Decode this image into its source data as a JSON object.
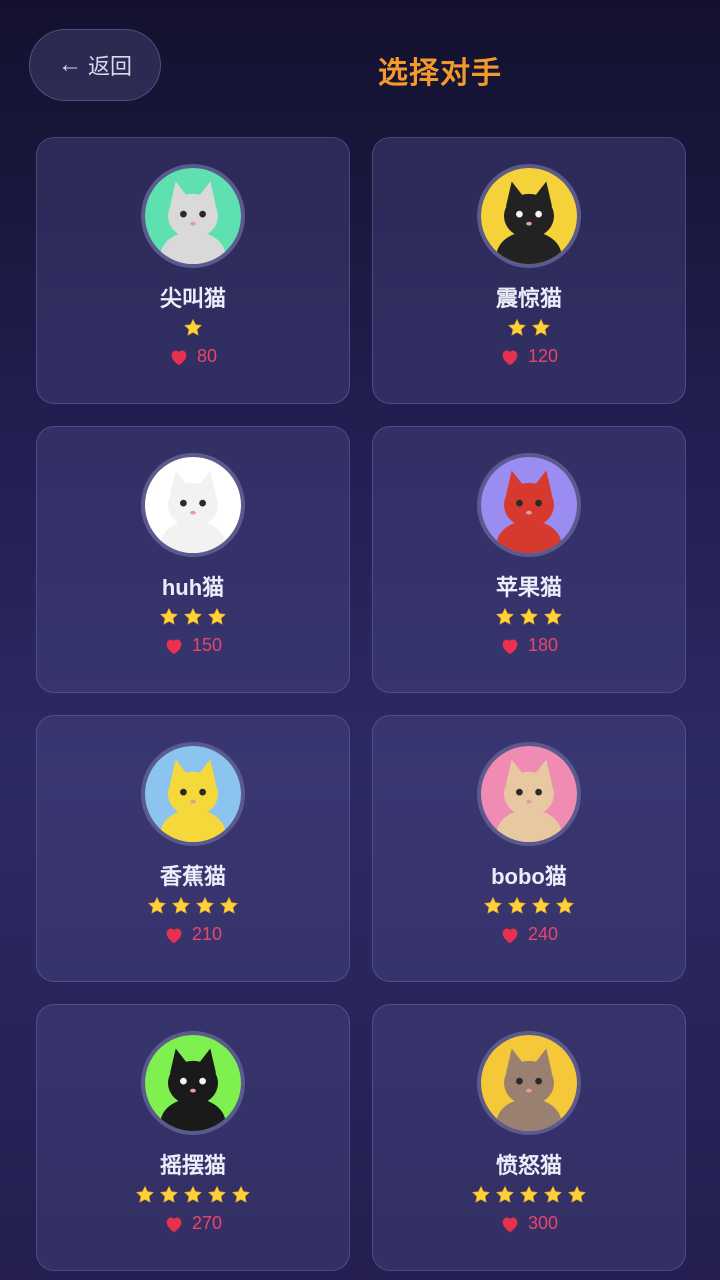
{
  "header": {
    "back_label": "返回",
    "back_arrow": "←",
    "title": "选择对手"
  },
  "colors": {
    "title": "#f29a2a",
    "star": "#ffd23c",
    "heart": "#e8304f"
  },
  "opponents": [
    {
      "name": "尖叫猫",
      "stars": 1,
      "hp": "80",
      "avatar_bg": "#5fe0b0",
      "cat_color": "#d9d9d9"
    },
    {
      "name": "震惊猫",
      "stars": 2,
      "hp": "120",
      "avatar_bg": "#f5d23a",
      "cat_color": "#222222"
    },
    {
      "name": "huh猫",
      "stars": 3,
      "hp": "150",
      "avatar_bg": "#ffffff",
      "cat_color": "#f2f2f2"
    },
    {
      "name": "苹果猫",
      "stars": 3,
      "hp": "180",
      "avatar_bg": "#9a8cf0",
      "cat_color": "#d63a2e"
    },
    {
      "name": "香蕉猫",
      "stars": 4,
      "hp": "210",
      "avatar_bg": "#8cc4f0",
      "cat_color": "#f5d93a"
    },
    {
      "name": "bobo猫",
      "stars": 4,
      "hp": "240",
      "avatar_bg": "#f08cb4",
      "cat_color": "#e8c8a0"
    },
    {
      "name": "摇摆猫",
      "stars": 5,
      "hp": "270",
      "avatar_bg": "#7ef050",
      "cat_color": "#1a1a1a"
    },
    {
      "name": "愤怒猫",
      "stars": 5,
      "hp": "300",
      "avatar_bg": "#f5c83a",
      "cat_color": "#9a8070"
    }
  ]
}
